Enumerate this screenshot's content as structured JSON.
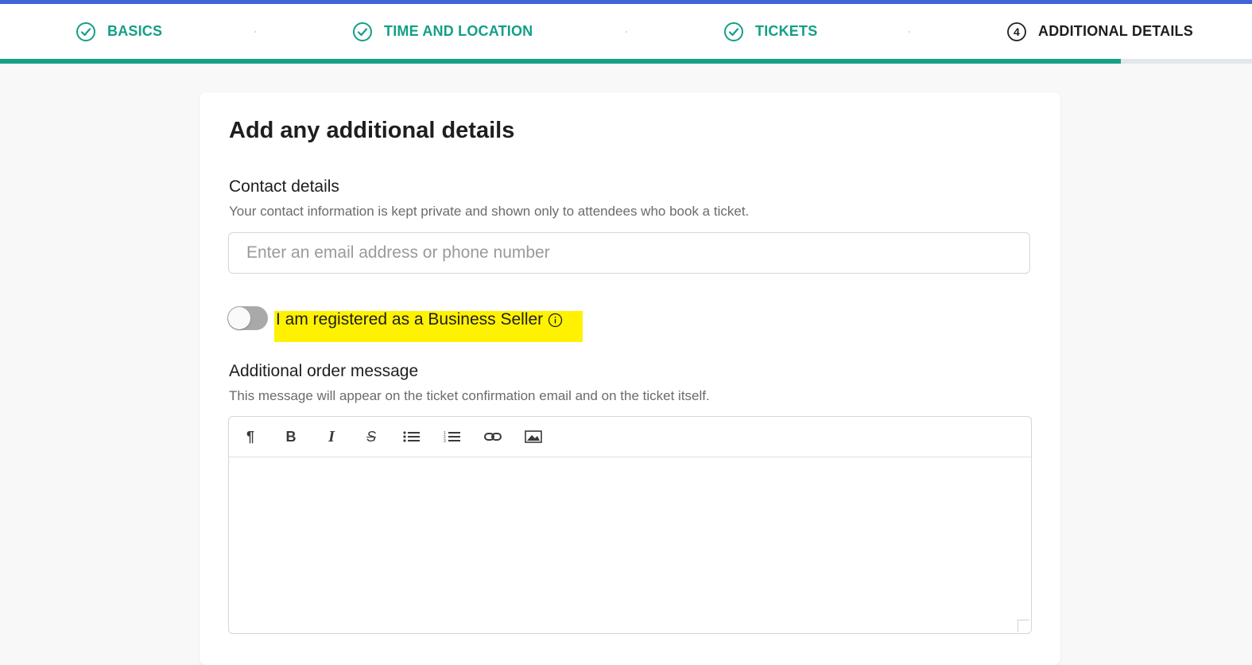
{
  "colors": {
    "accent_top": "#3d64d8",
    "step_done": "#139f86",
    "progress_fill": "#16a085",
    "highlight": "#fff200"
  },
  "stepper": {
    "steps": [
      {
        "label": "BASICS",
        "status": "done",
        "icon": "check-circle-icon"
      },
      {
        "label": "TIME AND LOCATION",
        "status": "done",
        "icon": "check-circle-icon"
      },
      {
        "label": "TICKETS",
        "status": "done",
        "icon": "check-circle-icon"
      },
      {
        "label": "ADDITIONAL DETAILS",
        "status": "current",
        "number": "4",
        "icon": "numbered-circle-icon"
      }
    ],
    "progress_fraction": 0.895
  },
  "card": {
    "title": "Add any additional details",
    "contact": {
      "label": "Contact details",
      "help": "Your contact information is kept private and shown only to attendees who book a ticket.",
      "placeholder": "Enter an email address or phone number",
      "value": ""
    },
    "business_seller": {
      "label": "I am registered as a Business Seller",
      "enabled": false,
      "info_icon": "info-icon"
    },
    "order_message": {
      "label": "Additional order message",
      "help": "This message will appear on the ticket confirmation email and on the ticket itself.",
      "toolbar": [
        {
          "name": "paragraph-icon",
          "glyph": "¶"
        },
        {
          "name": "bold-icon",
          "glyph": "B"
        },
        {
          "name": "italic-icon",
          "glyph": "I"
        },
        {
          "name": "strikethrough-icon",
          "glyph": "S"
        },
        {
          "name": "bullet-list-icon",
          "glyph": "•"
        },
        {
          "name": "numbered-list-icon",
          "glyph": "1."
        },
        {
          "name": "link-icon",
          "glyph": "link"
        },
        {
          "name": "image-icon",
          "glyph": "img"
        }
      ],
      "value": ""
    }
  }
}
